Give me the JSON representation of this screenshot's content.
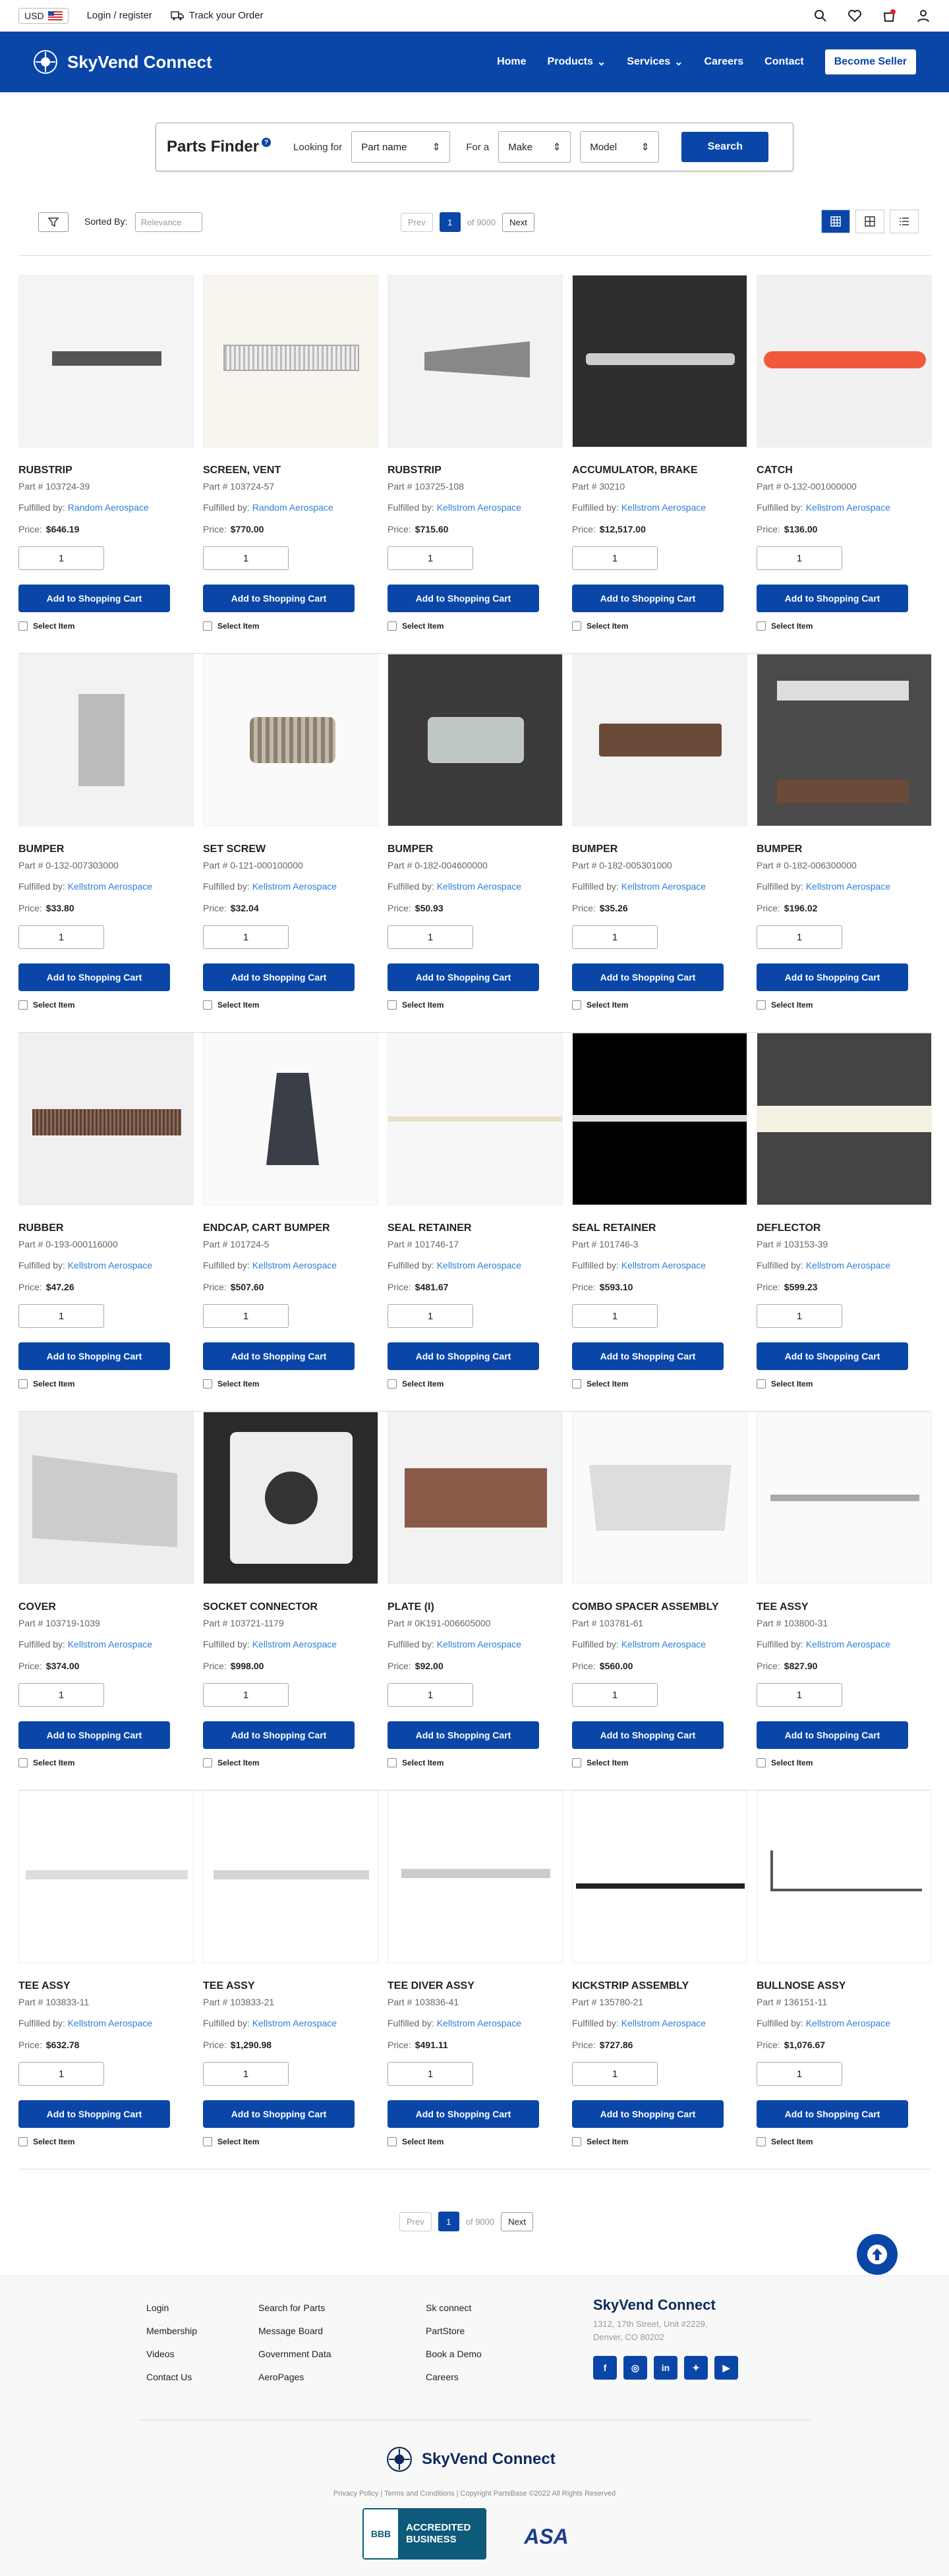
{
  "topbar": {
    "currency": "USD",
    "login": "Login / register",
    "track": "Track your Order"
  },
  "header": {
    "brand": "SkyVend Connect",
    "nav": [
      "Home",
      "Products",
      "Services",
      "Careers",
      "Contact"
    ],
    "seller": "Become Seller"
  },
  "finder": {
    "title": "Parts Finder",
    "help": "?",
    "looking_for": "Looking for",
    "part_select": "Part name",
    "for_a": "For a",
    "make_select": "Make",
    "model_select": "Model",
    "search": "Search"
  },
  "controls": {
    "sorted_by": "Sorted By:",
    "sort_placeholder": "Relevance"
  },
  "pager": {
    "prev": "Prev",
    "page": "1",
    "of": "of 9000",
    "next": "Next"
  },
  "labels": {
    "part_prefix": "Part # ",
    "fulfilled": "Fulfilled by: ",
    "price": "Price:",
    "qty": "1",
    "add": "Add to Shopping Cart",
    "select": "Select Item"
  },
  "products": [
    {
      "name": "RUBSTRIP",
      "part": "103724-39",
      "seller": "Random Aerospace",
      "price": "$646.19"
    },
    {
      "name": "SCREEN, VENT",
      "part": "103724-57",
      "seller": "Random Aerospace",
      "price": "$770.00"
    },
    {
      "name": "RUBSTRIP",
      "part": "103725-108",
      "seller": "Kellstrom Aerospace",
      "price": "$715.60"
    },
    {
      "name": "ACCUMULATOR, BRAKE",
      "part": "30210",
      "seller": "Kellstrom Aerospace",
      "price": "$12,517.00"
    },
    {
      "name": "CATCH",
      "part": "0-132-001000000",
      "seller": "Kellstrom Aerospace",
      "price": "$136.00"
    },
    {
      "name": "BUMPER",
      "part": "0-132-007303000",
      "seller": "Kellstrom Aerospace",
      "price": "$33.80"
    },
    {
      "name": "SET SCREW",
      "part": "0-121-000100000",
      "seller": "Kellstrom Aerospace",
      "price": "$32.04"
    },
    {
      "name": "BUMPER",
      "part": "0-182-004600000",
      "seller": "Kellstrom Aerospace",
      "price": "$50.93"
    },
    {
      "name": "BUMPER",
      "part": "0-182-005301000",
      "seller": "Kellstrom Aerospace",
      "price": "$35.26"
    },
    {
      "name": "BUMPER",
      "part": "0-182-006300000",
      "seller": "Kellstrom Aerospace",
      "price": "$196.02"
    },
    {
      "name": "RUBBER",
      "part": "0-193-000116000",
      "seller": "Kellstrom Aerospace",
      "price": "$47.26"
    },
    {
      "name": "ENDCAP, CART BUMPER",
      "part": "101724-5",
      "seller": "Kellstrom Aerospace",
      "price": "$507.60"
    },
    {
      "name": "SEAL RETAINER",
      "part": "101746-17",
      "seller": "Kellstrom Aerospace",
      "price": "$481.67"
    },
    {
      "name": "SEAL RETAINER",
      "part": "101746-3",
      "seller": "Kellstrom Aerospace",
      "price": "$593.10"
    },
    {
      "name": "DEFLECTOR",
      "part": "103153-39",
      "seller": "Kellstrom Aerospace",
      "price": "$599.23"
    },
    {
      "name": "COVER",
      "part": "103719-1039",
      "seller": "Kellstrom Aerospace",
      "price": "$374.00"
    },
    {
      "name": "SOCKET CONNECTOR",
      "part": "103721-1179",
      "seller": "Kellstrom Aerospace",
      "price": "$998.00"
    },
    {
      "name": "PLATE (I)",
      "part": "0K191-006605000",
      "seller": "Kellstrom Aerospace",
      "price": "$92.00"
    },
    {
      "name": "COMBO SPACER ASSEMBLY",
      "part": "103781-61",
      "seller": "Kellstrom Aerospace",
      "price": "$560.00"
    },
    {
      "name": "TEE ASSY",
      "part": "103800-31",
      "seller": "Kellstrom Aerospace",
      "price": "$827.90"
    },
    {
      "name": "TEE ASSY",
      "part": "103833-11",
      "seller": "Kellstrom Aerospace",
      "price": "$632.78"
    },
    {
      "name": "TEE ASSY",
      "part": "103833-21",
      "seller": "Kellstrom Aerospace",
      "price": "$1,290.98"
    },
    {
      "name": "TEE DIVER ASSY",
      "part": "103836-41",
      "seller": "Kellstrom Aerospace",
      "price": "$491.11"
    },
    {
      "name": "KICKSTRIP ASSEMBLY",
      "part": "135780-21",
      "seller": "Kellstrom Aerospace",
      "price": "$727.86"
    },
    {
      "name": "BULLNOSE ASSY",
      "part": "136151-11",
      "seller": "Kellstrom Aerospace",
      "price": "$1,076.67"
    }
  ],
  "footer": {
    "col1": [
      "Login",
      "Membership",
      "Videos",
      "Contact Us"
    ],
    "col2": [
      "Search for Parts",
      "Message Board",
      "Government Data",
      "AeroPages"
    ],
    "col3": [
      "Sk connect",
      "PartStore",
      "Book a Demo",
      "Careers"
    ],
    "brand": "SkyVend Connect",
    "address1": "1312, 17th Street, Unit #2229,",
    "address2": "Denver, CO 80202",
    "copyright": "Privacy Policy  |  Terms and Conditions  |  Copyright PartsBase ©2022 All Rights Reserved",
    "bbb_line1": "ACCREDITED",
    "bbb_line2": "BUSINESS",
    "bbb_logo": "BBB",
    "asa": "ASA"
  },
  "colors": {
    "brand": "#0a46a8",
    "link": "#2f7fd8"
  }
}
